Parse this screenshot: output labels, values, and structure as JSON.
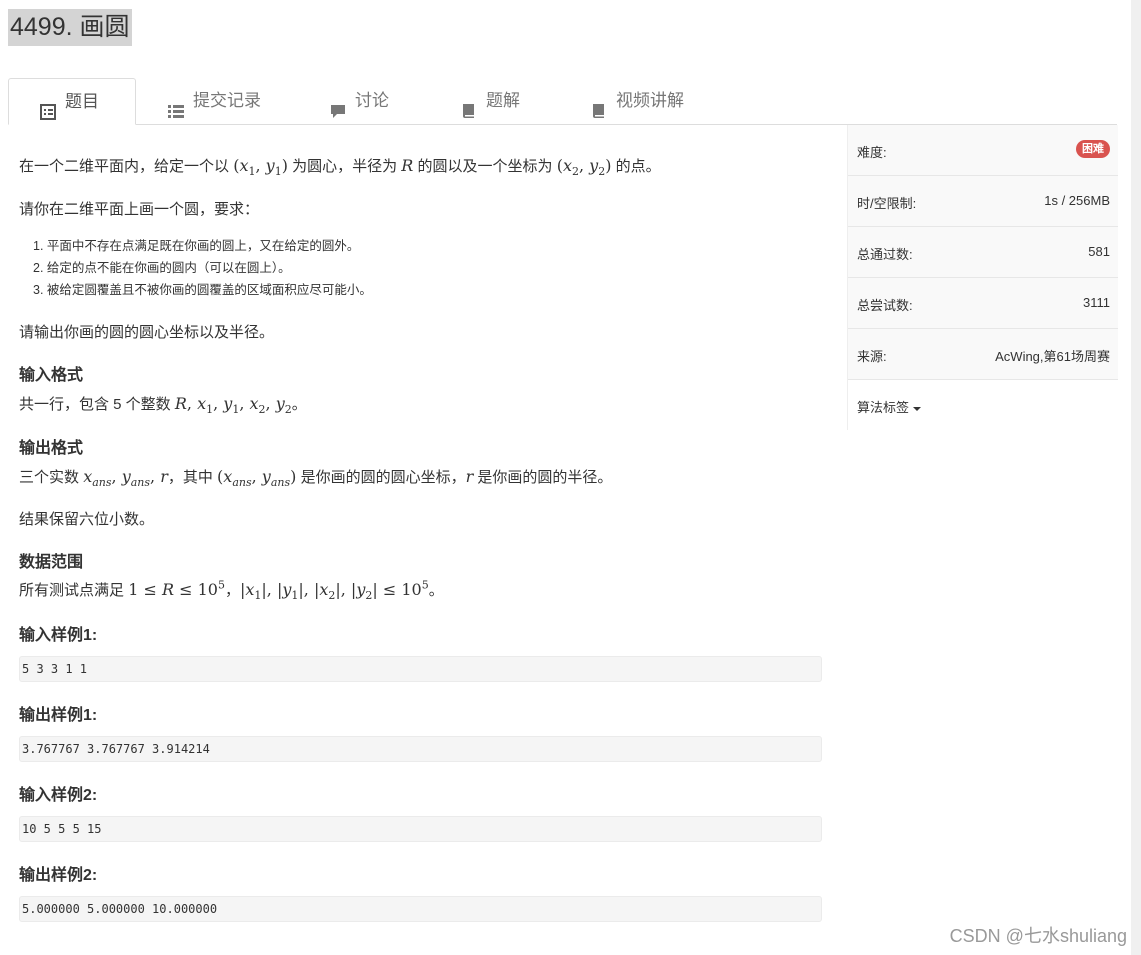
{
  "title": "4499. 画圆",
  "tabs": [
    {
      "label": "题目",
      "icon": "list-alt-icon"
    },
    {
      "label": "提交记录",
      "icon": "list-icon"
    },
    {
      "label": "讨论",
      "icon": "comment-icon"
    },
    {
      "label": "题解",
      "icon": "book-icon"
    },
    {
      "label": "视频讲解",
      "icon": "book-icon"
    }
  ],
  "problem": {
    "p1_a": "在一个二维平面内，给定一个以",
    "p1_b": "为圆心，半径为",
    "p1_c": "的圆以及一个坐标为",
    "p1_d": "的点。",
    "p2": "请你在二维平面上画一个圆，要求：",
    "reqs": [
      "1. 平面中不存在点满足既在你画的圆上，又在给定的圆外。",
      "2. 给定的点不能在你画的圆内（可以在圆上）。",
      "3. 被给定圆覆盖且不被你画的圆覆盖的区域面积应尽可能小。"
    ],
    "p3": "请输出你画的圆的圆心坐标以及半径。",
    "input_h": "输入格式",
    "input_a": "共一行，包含 5 个整数",
    "input_b": "。",
    "output_h": "输出格式",
    "output_a": "三个实数",
    "output_b": "，其中",
    "output_c": "是你画的圆的圆心坐标，",
    "output_d": "是你画的圆的半径。",
    "p_keep": "结果保留六位小数。",
    "range_h": "数据范围",
    "range_a": "所有测试点满足",
    "range_b": "，",
    "range_c": "。",
    "sample_in1_h": "输入样例1:",
    "sample_in1": "5 3 3 1 1",
    "sample_out1_h": "输出样例1:",
    "sample_out1": "3.767767 3.767767 3.914214",
    "sample_in2_h": "输入样例2:",
    "sample_in2": "10 5 5 5 15",
    "sample_out2_h": "输出样例2:",
    "sample_out2": "5.000000 5.000000 10.000000"
  },
  "side": {
    "difficulty_k": "难度:",
    "difficulty_v": "困难",
    "limit_k": "时/空限制:",
    "limit_v": "1s / 256MB",
    "pass_k": "总通过数:",
    "pass_v": "581",
    "try_k": "总尝试数:",
    "try_v": "3111",
    "source_k": "来源:",
    "source_v": "AcWing,第61场周赛",
    "tags_k": "算法标签",
    "difficulty_color": "#d9534f"
  },
  "watermark": "CSDN @七水shuliang"
}
